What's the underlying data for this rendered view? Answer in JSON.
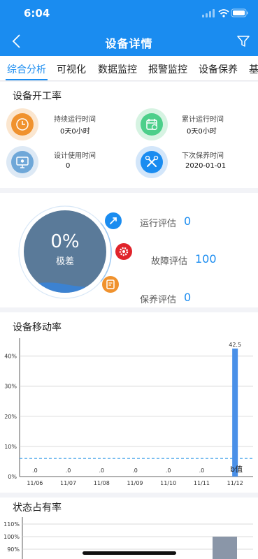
{
  "status": {
    "time": "6:04"
  },
  "header": {
    "title": "设备详情"
  },
  "tabs": [
    "综合分析",
    "可视化",
    "数据监控",
    "报警监控",
    "设备保养",
    "基"
  ],
  "work_rate": {
    "title": "设备开工率",
    "stats": [
      {
        "label": "持续运行时间",
        "value": "0天0小时",
        "icon": "clock-icon",
        "color": "#f0922e"
      },
      {
        "label": "累计运行时间",
        "value": "0天0小时",
        "icon": "calendar-icon",
        "color": "#4ccf8a"
      },
      {
        "label": "设计使用时间",
        "value": "0",
        "icon": "monitor-icon",
        "color": "#6ea7d8"
      },
      {
        "label": "下次保养时间",
        "value": "2020-01-01",
        "icon": "tools-icon",
        "color": "#1a8cf0"
      }
    ]
  },
  "evaluation": {
    "percent": "0%",
    "level": "极差",
    "items": [
      {
        "label": "运行评估",
        "value": "0"
      },
      {
        "label": "故障评估",
        "value": "100"
      },
      {
        "label": "保养评估",
        "value": "0"
      }
    ]
  },
  "mobility": {
    "title": "设备移动率",
    "value_label": "42.5",
    "baseline_label": "b值",
    "chart_data": {
      "type": "bar",
      "categories": [
        "11/06",
        "11/07",
        "11/08",
        "11/09",
        "11/10",
        "11/11",
        "11/12"
      ],
      "values": [
        0,
        0,
        0,
        0,
        0,
        0,
        42.5
      ],
      "bar_labels": [
        ".0",
        ".0",
        ".0",
        ".0",
        ".0",
        ".0",
        "42.5"
      ],
      "yticks": [
        "0%",
        "10%",
        "20%",
        "30%",
        "40%"
      ],
      "ylim": [
        0,
        45
      ],
      "reference_line": 6,
      "bar_color": "#4a90e8",
      "grid": true
    }
  },
  "occupancy": {
    "title": "状态占有率",
    "chart_data": {
      "type": "bar",
      "yticks": [
        "110%",
        "100%",
        "90%"
      ],
      "bar_color": "#8a96a8"
    }
  }
}
